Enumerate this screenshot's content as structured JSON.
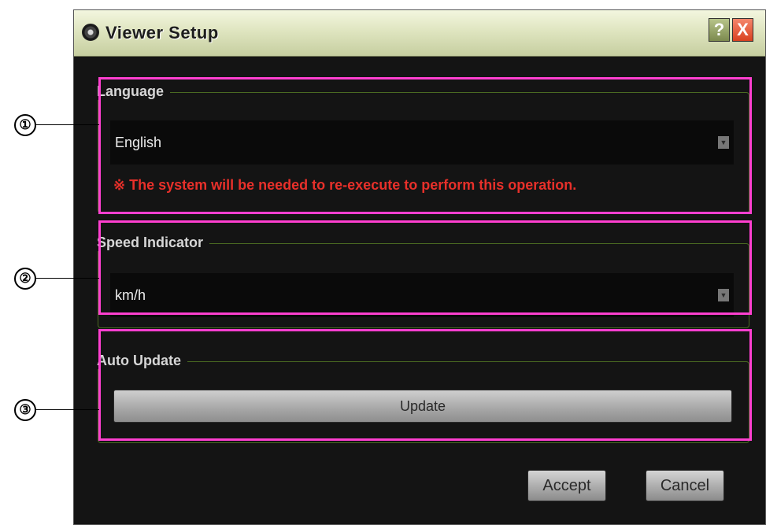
{
  "window": {
    "title": "Viewer Setup",
    "help_label": "?",
    "close_label": "X"
  },
  "language": {
    "group_label": "Language",
    "selected": "English",
    "warning": "※ The system will be needed to re-execute to perform this operation."
  },
  "speed": {
    "group_label": "Speed Indicator",
    "selected": "km/h"
  },
  "auto_update": {
    "group_label": "Auto Update",
    "button_label": "Update"
  },
  "actions": {
    "accept_label": "Accept",
    "cancel_label": "Cancel"
  },
  "callouts": [
    {
      "label": "①"
    },
    {
      "label": "②"
    },
    {
      "label": "③"
    }
  ],
  "icons": {
    "dropdown_arrow": "▼",
    "app": "viewer-app-icon"
  },
  "colors": {
    "highlight": "#ff3fd0",
    "warning": "#e8302a",
    "group_border": "#4a6a22",
    "window_bg": "#141414"
  }
}
